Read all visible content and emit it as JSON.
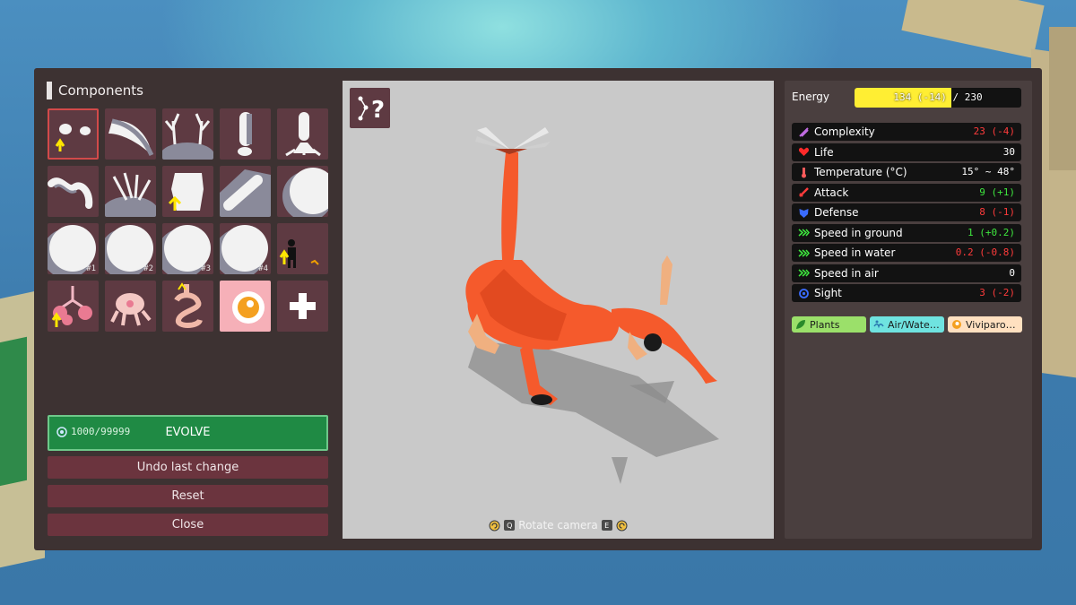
{
  "components_panel": {
    "title": "Components",
    "items": [
      {
        "name": "eyes-part",
        "selected": true
      },
      {
        "name": "tail-part"
      },
      {
        "name": "antlers-part"
      },
      {
        "name": "leg-part"
      },
      {
        "name": "clawed-leg-part"
      },
      {
        "name": "tentacle-part"
      },
      {
        "name": "claws-part"
      },
      {
        "name": "skin-part"
      },
      {
        "name": "bone-part"
      },
      {
        "name": "shell-part"
      },
      {
        "name": "shell-variant-1",
        "label": "#1"
      },
      {
        "name": "shell-variant-2",
        "label": "#2"
      },
      {
        "name": "shell-variant-3",
        "label": "#3"
      },
      {
        "name": "shell-variant-4",
        "label": "#4"
      },
      {
        "name": "body-size-part"
      },
      {
        "name": "lungs-part"
      },
      {
        "name": "brain-part"
      },
      {
        "name": "digestive-part"
      },
      {
        "name": "embryo-part"
      },
      {
        "name": "add-part"
      }
    ],
    "evolve": {
      "cost": "1000/99999",
      "label": "EVOLVE"
    },
    "undo_label": "Undo last change",
    "reset_label": "Reset",
    "close_label": "Close"
  },
  "viewport": {
    "rotate_label": "Rotate camera",
    "key_left": "Q",
    "key_right": "E"
  },
  "stats_panel": {
    "energy": {
      "label": "Energy",
      "text": "134 (-14) / 230",
      "fraction": 0.58
    },
    "stats": [
      {
        "label": "Complexity",
        "value": "23 (-4)",
        "value_color": "#ff3b3b",
        "icon": "complexity-icon",
        "icon_color": "#c06be0"
      },
      {
        "label": "Life",
        "value": "30",
        "value_color": "#ffffff",
        "icon": "heart-icon",
        "icon_color": "#ff2a2a"
      },
      {
        "label": "Temperature (°C)",
        "value": "15° ~ 48°",
        "value_color": "#ffffff",
        "icon": "thermometer-icon",
        "icon_color": "#ff5a5a"
      },
      {
        "label": "Attack",
        "value": "9 (+1)",
        "value_color": "#3ee63e",
        "icon": "sword-icon",
        "icon_color": "#ff3b3b"
      },
      {
        "label": "Defense",
        "value": "8 (-1)",
        "value_color": "#ff3b3b",
        "icon": "shield-icon",
        "icon_color": "#3a6cff"
      },
      {
        "label": "Speed in ground",
        "value": "1 (+0.2)",
        "value_color": "#3ee63e",
        "icon": "speed-ground-icon",
        "icon_color": "#3ee63e"
      },
      {
        "label": "Speed in water",
        "value": "0.2 (-0.8)",
        "value_color": "#ff3b3b",
        "icon": "speed-water-icon",
        "icon_color": "#3ee63e"
      },
      {
        "label": "Speed in air",
        "value": "0",
        "value_color": "#ffffff",
        "icon": "speed-air-icon",
        "icon_color": "#3ee63e"
      },
      {
        "label": "Sight",
        "value": "3 (-2)",
        "value_color": "#ff3b3b",
        "icon": "eye-icon",
        "icon_color": "#3a6cff"
      }
    ],
    "tags": [
      {
        "label": "Plants",
        "bg": "#9be06a",
        "icon": "leaf-icon"
      },
      {
        "label": "Air/Wate…",
        "bg": "#6fe3e0",
        "icon": "water-icon"
      },
      {
        "label": "Viviparo…",
        "bg": "#ffe0c0",
        "icon": "egg-icon"
      }
    ]
  }
}
